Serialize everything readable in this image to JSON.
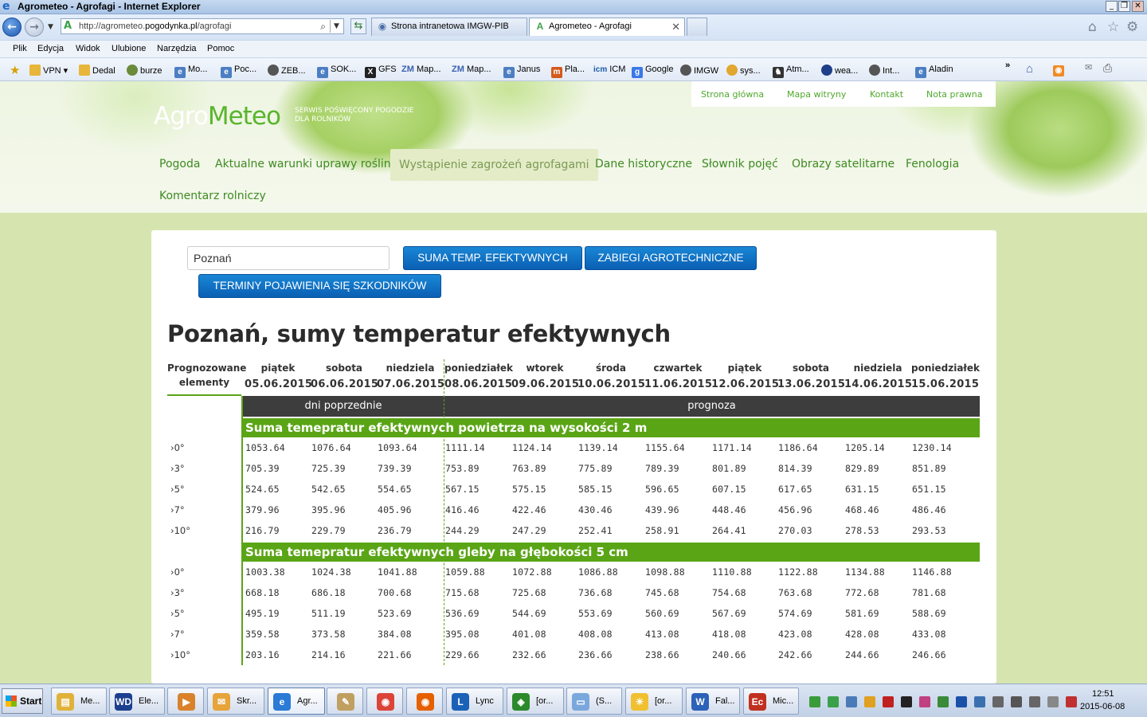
{
  "window": {
    "title": "Agrometeo - Agrofagi - Internet Explorer"
  },
  "browser": {
    "url_prefix": "http://agrometeo.",
    "url_domain": "pogodynka.pl",
    "url_path": "/agrofagi",
    "tabs": [
      {
        "label": "Strona intranetowa IMGW-PIB",
        "active": false
      },
      {
        "label": "Agrometeo - Agrofagi",
        "active": true
      }
    ],
    "menu": [
      "Plik",
      "Edycja",
      "Widok",
      "Ulubione",
      "Narzędzia",
      "Pomoc"
    ],
    "favorites": [
      "VPN",
      "Dedal",
      "burze",
      "Mo...",
      "Poc...",
      "ZEB...",
      "SOK...",
      "GFS",
      "Map...",
      "Map...",
      "Janus",
      "Pla...",
      "ICM",
      "Google",
      "IMGW",
      "sys...",
      "Atm...",
      "wea...",
      "Int...",
      "Aladin"
    ],
    "fav_prefixes": {
      "zm1": "ZM",
      "zm2": "ZM",
      "icm": "icm"
    }
  },
  "site": {
    "logo_part1": "Agro",
    "logo_part2": "Meteo",
    "slogan": "SERWIS POŚWIĘCONY POGODZIE DLA ROLNIKÓW",
    "top_links": [
      "Strona główna",
      "Mapa witryny",
      "Kontakt",
      "Nota prawna"
    ],
    "nav": [
      "Pogoda",
      "Aktualne warunki uprawy roślin",
      "Wystąpienie zagrożeń agrofagami",
      "Dane historyczne",
      "Słownik pojęć",
      "Obrazy satelitarne",
      "Fenologia",
      "Komentarz rolniczy"
    ],
    "nav_active_index": 2
  },
  "form": {
    "city_value": "Poznań",
    "btn_sum": "SUMA TEMP. EFEKTYWNYCH",
    "btn_treat": "ZABIEGI AGROTECHNICZNE",
    "btn_pests": "TERMINY POJAWIENIA SIĘ SZKODNIKÓW"
  },
  "page_title": "Poznań, sumy temperatur efektywnych",
  "table": {
    "corner_label_1": "Prognozowane",
    "corner_label_2": "elementy",
    "days": [
      "piątek",
      "sobota",
      "niedziela",
      "poniedziałek",
      "wtorek",
      "środa",
      "czwartek",
      "piątek",
      "sobota",
      "niedziela",
      "poniedziałek"
    ],
    "dates": [
      "05.06.2015",
      "06.06.2015",
      "07.06.2015",
      "08.06.2015",
      "09.06.2015",
      "10.06.2015",
      "11.06.2015",
      "12.06.2015",
      "13.06.2015",
      "14.06.2015",
      "15.06.2015"
    ],
    "band_past": "dni poprzednie",
    "band_forecast": "prognoza",
    "sections": [
      {
        "title": "Suma temepratur efektywnych powietrza na wysokości 2 m",
        "rows": [
          {
            "label": "›0°",
            "values": [
              "1053.64",
              "1076.64",
              "1093.64",
              "1111.14",
              "1124.14",
              "1139.14",
              "1155.64",
              "1171.14",
              "1186.64",
              "1205.14",
              "1230.14"
            ]
          },
          {
            "label": "›3°",
            "values": [
              "705.39",
              "725.39",
              "739.39",
              "753.89",
              "763.89",
              "775.89",
              "789.39",
              "801.89",
              "814.39",
              "829.89",
              "851.89"
            ]
          },
          {
            "label": "›5°",
            "values": [
              "524.65",
              "542.65",
              "554.65",
              "567.15",
              "575.15",
              "585.15",
              "596.65",
              "607.15",
              "617.65",
              "631.15",
              "651.15"
            ]
          },
          {
            "label": "›7°",
            "values": [
              "379.96",
              "395.96",
              "405.96",
              "416.46",
              "422.46",
              "430.46",
              "439.96",
              "448.46",
              "456.96",
              "468.46",
              "486.46"
            ]
          },
          {
            "label": "›10°",
            "values": [
              "216.79",
              "229.79",
              "236.79",
              "244.29",
              "247.29",
              "252.41",
              "258.91",
              "264.41",
              "270.03",
              "278.53",
              "293.53"
            ]
          }
        ]
      },
      {
        "title": "Suma temepratur efektywnych gleby na głębokości 5 cm",
        "rows": [
          {
            "label": "›0°",
            "values": [
              "1003.38",
              "1024.38",
              "1041.88",
              "1059.88",
              "1072.88",
              "1086.88",
              "1098.88",
              "1110.88",
              "1122.88",
              "1134.88",
              "1146.88"
            ]
          },
          {
            "label": "›3°",
            "values": [
              "668.18",
              "686.18",
              "700.68",
              "715.68",
              "725.68",
              "736.68",
              "745.68",
              "754.68",
              "763.68",
              "772.68",
              "781.68"
            ]
          },
          {
            "label": "›5°",
            "values": [
              "495.19",
              "511.19",
              "523.69",
              "536.69",
              "544.69",
              "553.69",
              "560.69",
              "567.69",
              "574.69",
              "581.69",
              "588.69"
            ]
          },
          {
            "label": "›7°",
            "values": [
              "359.58",
              "373.58",
              "384.08",
              "395.08",
              "401.08",
              "408.08",
              "413.08",
              "418.08",
              "423.08",
              "428.08",
              "433.08"
            ]
          },
          {
            "label": "›10°",
            "values": [
              "203.16",
              "214.16",
              "221.66",
              "229.66",
              "232.66",
              "236.66",
              "238.66",
              "240.66",
              "242.66",
              "244.66",
              "246.66"
            ]
          }
        ]
      }
    ]
  },
  "taskbar": {
    "start_label": "Start",
    "tasks": [
      "Me...",
      "Ele...",
      "",
      "Skr...",
      "Agr...",
      "",
      "",
      "",
      "Lync",
      "[or...",
      "(S...",
      "[or...",
      "Fal...",
      "Mic..."
    ],
    "clock_time": "12:51",
    "clock_date": "2015-06-08"
  },
  "colors": {
    "brand_green": "#58b52d",
    "section_green": "#5aa516",
    "band_dark": "#3d3d3d",
    "button_blue": "#0a6cc2"
  }
}
